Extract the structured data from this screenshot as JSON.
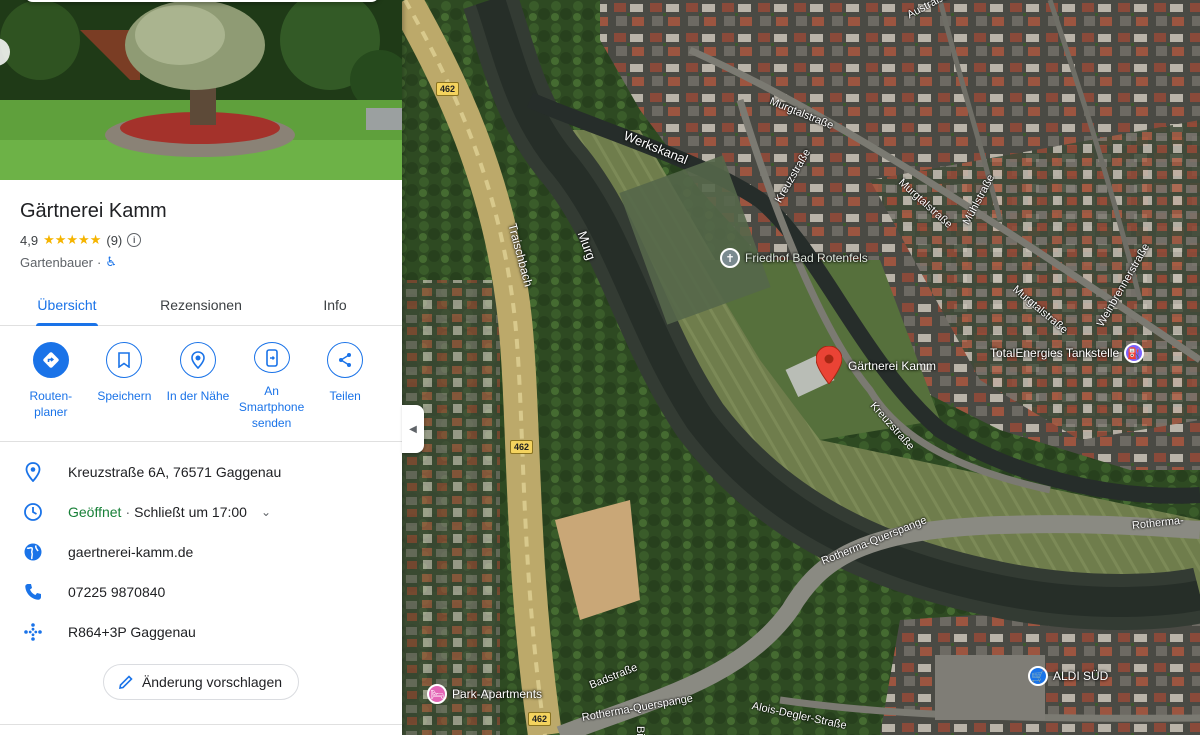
{
  "place": {
    "name": "Gärtnerei Kamm",
    "rating": "4,9",
    "stars": "★★★★★",
    "review_count": "(9)",
    "info_symbol": "i",
    "category": "Gartenbauer",
    "category_sep": "·"
  },
  "tabs": [
    {
      "label": "Übersicht",
      "active": true
    },
    {
      "label": "Rezensionen",
      "active": false
    },
    {
      "label": "Info",
      "active": false
    }
  ],
  "actions": [
    {
      "label": "Routen-\nplaner",
      "icon": "directions-icon"
    },
    {
      "label": "Speichern",
      "icon": "bookmark-icon"
    },
    {
      "label": "In der Nähe",
      "icon": "nearby-icon"
    },
    {
      "label": "An\nSmartphone\nsenden",
      "icon": "send-to-phone-icon"
    },
    {
      "label": "Teilen",
      "icon": "share-icon"
    }
  ],
  "details": {
    "address": "Kreuzstraße 6A, 76571 Gaggenau",
    "hours_status": "Geöffnet",
    "hours_sep": "·",
    "hours_close": "Schließt um 17:00",
    "website": "gaertnerei-kamm.de",
    "phone": "07225 9870840",
    "plus_code": "R864+3P Gaggenau"
  },
  "suggest_edit": "Änderung vorschlagen",
  "map": {
    "labels": {
      "werkskanal": "Werkskanal",
      "murg": "Murg",
      "traischbach": "Traischbach",
      "austrasse": "Austraße",
      "murgtalstrasse_1": "Murgtalstraße",
      "murgtalstrasse_2": "Murgtalstraße",
      "murgtalstrasse_3": "Murgtalstraße",
      "muehlstrasse": "Mühlstraße",
      "weinbrennerstrasse": "Weinbrennerstraße",
      "kreuzstrasse_1": "Kreuzstraße",
      "kreuzstrasse_2": "Kreuzstraße",
      "rotherma_querspange_1": "Rotherma-Querspange",
      "rotherma_querspange_2": "Rotherma-",
      "rotherma_querspange_3": "Rotherma-Querspange",
      "badstrasse": "Badstraße",
      "alois_degler": "Alois-Degler-Straße",
      "bis": "Bis",
      "shield_top": "462",
      "shield_mid": "462",
      "shield_bottom": "462"
    },
    "pois": {
      "friedhof": "Friedhof Bad Rotenfels",
      "gaertnerei": "Gärtnerei Kamm",
      "total": "TotalEnergies Tankstelle",
      "park": "Park-Apartments",
      "aldi": "ALDI SÜD"
    },
    "collapse_arrow": "◀"
  },
  "colors": {
    "accent": "#1a73e8",
    "open": "#188038",
    "star": "#f5b400",
    "pin": "#ea4335"
  }
}
